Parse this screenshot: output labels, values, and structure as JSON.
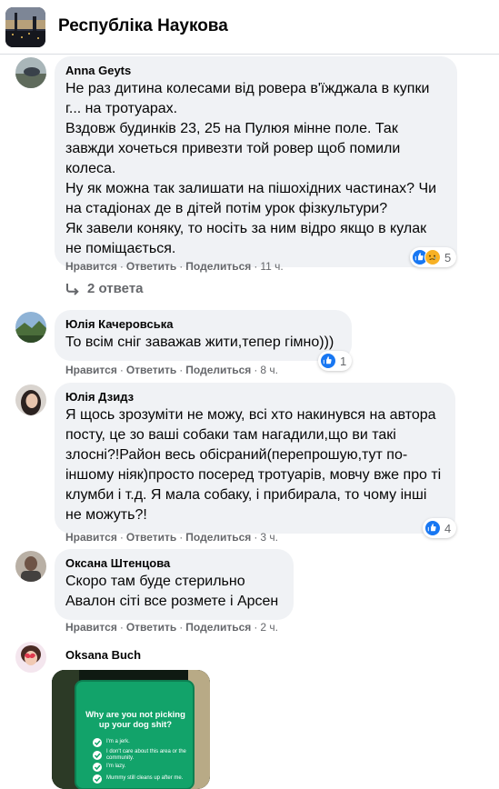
{
  "group": {
    "title": "Республіка Наукова"
  },
  "actions": {
    "like": "Нравится",
    "reply": "Ответить",
    "share": "Поделиться",
    "dot": "·"
  },
  "comments": [
    {
      "author": "Anna Geyts",
      "text": "Не раз дитина колесами від ровера в'їжджала в купки г... на тротуарах.\nВздовж будинків 23, 25 на Пулюя мінне поле. Так завжди хочеться привезти той ровер щоб помили колеса.\nНу як можна так залишати на пішохідних частинах? Чи на стадіонах де в дітей потім урок фізкультури?\nЯк завели коняку, то носіть за ним відро якщо в кулак не поміщається.",
      "time": "11 ч.",
      "reaction_count": "5",
      "reactions": [
        "like-icon",
        "sad-icon"
      ],
      "replies": "2 ответа"
    },
    {
      "author": "Юлія Качеровська",
      "text": "То всім сніг заважав жити,тепер гімно)))",
      "time": "8 ч.",
      "reaction_count": "1",
      "reactions": [
        "like-icon"
      ]
    },
    {
      "author": "Юлія Дзидз",
      "text": "Я щось зрозуміти не можу, всі хто накинувся на автора посту, це зо ваші собаки там нагадили,що ви такі злосні?!Район весь обісраний(перепрошую,тут по-іншому ніяк)просто посеред тротуарів, мовчу вже про ті клумби і т.д. Я мала собаку, і прибирала, то чому інші не можуть?!",
      "time": "3 ч.",
      "reaction_count": "4",
      "reactions": [
        "like-icon"
      ]
    },
    {
      "author": "Оксана Штенцова",
      "text": "Скоро там буде стерильно\nАвалон сіті все розмете і Арсен",
      "time": "2 ч."
    },
    {
      "author": "Oksana Buch",
      "photo": {
        "heading": "Why are you not picking up your dog shit?",
        "items": [
          "I'm a jerk.",
          "I don't care about this area or the community.",
          "I'm lazy.",
          "Mummy still cleans up after me."
        ]
      }
    }
  ],
  "colors": {
    "like": "#1877f2",
    "sad": "#f7b125",
    "bubble": "#f0f2f5",
    "meta": "#65676b",
    "sign": "#12a36a"
  }
}
